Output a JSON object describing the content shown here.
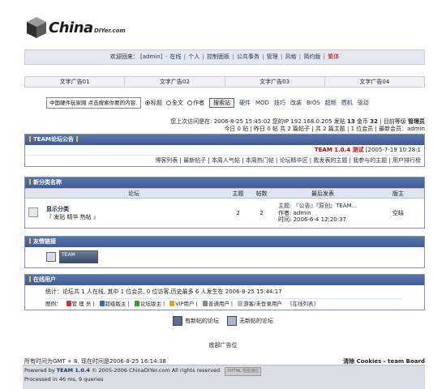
{
  "header": {
    "logo_text": "China",
    "logo_sub": "DIYer.com"
  },
  "userbar": {
    "greeting": "欢迎回来：",
    "username": "[admin]",
    "links": [
      "在线",
      "个人",
      "控制面板",
      "公共事务",
      "管理",
      "风格",
      "简约版"
    ],
    "logout": "繁体"
  },
  "adrow": [
    "文字广告01",
    "文字广告02",
    "文字广告03",
    "文字广告04"
  ],
  "search": {
    "placeholder": "中国硬件玩家网 点击搜索你要的内容.",
    "options": [
      "标题",
      "全文",
      "作者"
    ],
    "button": "搜索站",
    "keywords": [
      "硬件",
      "MOD",
      "技巧",
      "改装",
      "BIOS",
      "超频",
      "攒机",
      "驱动"
    ]
  },
  "visit": {
    "line1_pre": "您上次访问是在: 2006-8-25 15:45:02  您的IP 192.168.0.205  发贴 ",
    "posts": "13",
    "line1_mid": " 金币 ",
    "coins": "32",
    "line1_mid2": " | 目前等级 ",
    "level": "管理员",
    "line2": "今日 0 贴 | 昨日 0 帖  共 2 篇帖子 | 共 2 篇主题 | 1 位会员 | 最新会员：admin"
  },
  "announce": {
    "title": "TEAM论坛公告",
    "version": "TEAM 1.0.4 测试",
    "date": "[2005-7-19 10:28:1",
    "links": [
      "博客列表",
      "最新帖子",
      "本周人气帖",
      "本周热门帖",
      "论坛精华区",
      "我发表的主题",
      "我参与的主题",
      "用户排行榜"
    ]
  },
  "category": {
    "title": "新分类名称",
    "headers": [
      "论坛",
      "主题",
      "帖数",
      "最后发表",
      "版主"
    ],
    "forum": {
      "name": "显示分类",
      "sub": "『 发贴 精华 热帖 』",
      "topics": "2",
      "posts": "2",
      "last_title": "主题: 『公告』『原创』TEAM...",
      "last_author": "作者: admin",
      "last_time": "时间: 2006-6-4 12:20:37",
      "moderator": "空缺"
    }
  },
  "links_section": {
    "title": "友情链接",
    "banner": "TEAM"
  },
  "online": {
    "title": "在线用户",
    "stats": "统计：论坛共 1 人在线, 其中 1 位会员, 0 位访客,历史最多 6 人发生在 2006-8-25 15:44:17",
    "legend_label": "图例：",
    "legend": [
      "管 理 员",
      "超级版主",
      "论坛版主",
      "VIP用户",
      "普通用户",
      "游客/未登录用户"
    ],
    "list_link": "[在线列表]"
  },
  "footer": {
    "new_posts": "有新帖的论坛",
    "no_new_posts": "无新帖的论坛",
    "bottom_ad": "底部广告位",
    "timeline": "所有时间为GMT + 8, 现在时间是2006-8-25 16:14:38",
    "clear_cookies": "清除 Cookies - team Board",
    "powered_pre": "Powered by ",
    "powered_name": "TEAM 1.0.4",
    "powered_post": " © 2005-2006 ChinaDIYer.com All rights reserved",
    "xhtml_badge": "XHTML 检验通过",
    "processed": "Processed in 46 ms, 9 queries"
  },
  "colors": {
    "section_head": "#4a66a0",
    "accent_red": "#cc0000",
    "bar_yellow": "#f2c230"
  }
}
